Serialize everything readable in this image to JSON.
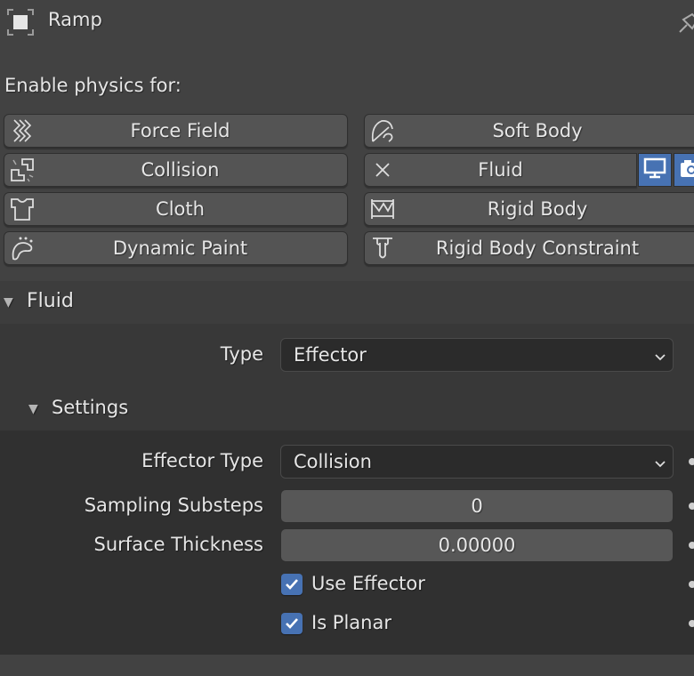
{
  "header": {
    "object_name": "Ramp",
    "object_icon": "object-data-icon",
    "pin_icon": "pin-icon"
  },
  "physics": {
    "enable_label": "Enable physics for:",
    "buttons": [
      {
        "label": "Force Field",
        "icon": "force-field-icon"
      },
      {
        "label": "Soft Body",
        "icon": "soft-body-icon"
      },
      {
        "label": "Collision",
        "icon": "collision-icon"
      },
      {
        "label": "Fluid",
        "icon": "remove-x-icon",
        "enabled": true
      },
      {
        "label": "Cloth",
        "icon": "cloth-icon"
      },
      {
        "label": "Rigid Body",
        "icon": "rigid-body-icon"
      },
      {
        "label": "Dynamic Paint",
        "icon": "dynamic-paint-icon"
      },
      {
        "label": "Rigid Body Constraint",
        "icon": "rigid-body-constraint-icon"
      }
    ],
    "fluid_toggles": [
      "viewport-icon",
      "render-camera-icon"
    ]
  },
  "fluid_panel": {
    "title": "Fluid",
    "type_label": "Type",
    "type_value": "Effector",
    "settings": {
      "title": "Settings",
      "effector_type_label": "Effector Type",
      "effector_type_value": "Collision",
      "sampling_substeps_label": "Sampling Substeps",
      "sampling_substeps_value": "0",
      "surface_thickness_label": "Surface Thickness",
      "surface_thickness_value": "0.00000",
      "use_effector_label": "Use Effector",
      "use_effector_checked": true,
      "is_planar_label": "Is Planar",
      "is_planar_checked": true
    }
  },
  "colors": {
    "accent": "#4772b3",
    "background": "#424242",
    "panel": "#383838",
    "subpanel": "#303030"
  }
}
